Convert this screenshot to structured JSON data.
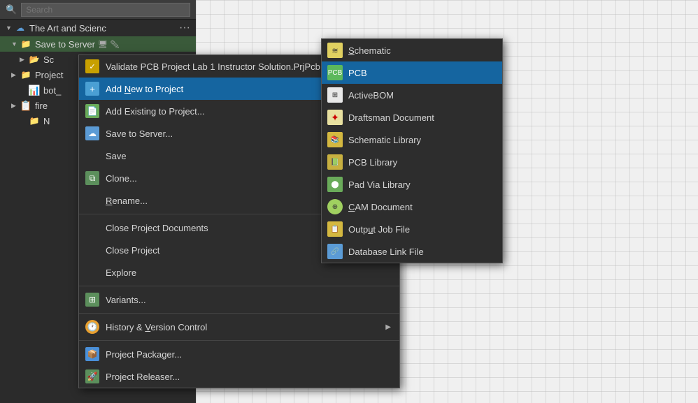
{
  "sidebar": {
    "search_placeholder": "Search",
    "items": [
      {
        "id": "cloud-root",
        "label": "The Art and Scienc",
        "level": 0,
        "icon": "cloud",
        "has_dots": true
      },
      {
        "id": "project-root",
        "label": "Save to Server",
        "level": 1,
        "icon": "folder-green"
      },
      {
        "id": "sc-folder",
        "label": "Sc",
        "level": 2,
        "icon": "folder-green"
      },
      {
        "id": "project-item",
        "label": "Project",
        "level": 1,
        "icon": "folder-blue"
      },
      {
        "id": "bot-item",
        "label": "bot_",
        "level": 2,
        "icon": "excel"
      },
      {
        "id": "fire-item",
        "label": "fire",
        "level": 1,
        "icon": "file"
      },
      {
        "id": "n-item",
        "label": "N",
        "level": 2,
        "icon": "folder-orange"
      }
    ]
  },
  "context_menu": {
    "items": [
      {
        "id": "validate",
        "label": "Validate PCB Project Lab 1 Instructor Solution.PrjPcb",
        "icon": "validate",
        "has_arrow": false
      },
      {
        "id": "add-new",
        "label": "Add New to Project",
        "icon": "add-new",
        "has_arrow": true,
        "highlighted": true
      },
      {
        "id": "add-existing",
        "label": "Add Existing to Project...",
        "icon": "add-existing",
        "has_arrow": false
      },
      {
        "id": "save-server",
        "label": "Save to Server...",
        "icon": "save-server",
        "has_arrow": false
      },
      {
        "id": "save",
        "label": "Save",
        "icon": null,
        "has_arrow": false
      },
      {
        "id": "clone",
        "label": "Clone...",
        "icon": "clone",
        "has_arrow": false
      },
      {
        "id": "rename",
        "label": "Rename...",
        "icon": null,
        "has_arrow": false
      },
      {
        "id": "sep1",
        "type": "separator"
      },
      {
        "id": "close-docs",
        "label": "Close Project Documents",
        "icon": null,
        "has_arrow": false
      },
      {
        "id": "close-project",
        "label": "Close Project",
        "icon": null,
        "has_arrow": false
      },
      {
        "id": "explore",
        "label": "Explore",
        "icon": null,
        "has_arrow": false
      },
      {
        "id": "sep2",
        "type": "separator"
      },
      {
        "id": "variants",
        "label": "Variants...",
        "icon": "variants",
        "has_arrow": false
      },
      {
        "id": "sep3",
        "type": "separator"
      },
      {
        "id": "history",
        "label": "History & Version Control",
        "icon": "history",
        "has_arrow": true
      },
      {
        "id": "sep4",
        "type": "separator"
      },
      {
        "id": "packager",
        "label": "Project Packager...",
        "icon": "packager",
        "has_arrow": false
      },
      {
        "id": "releaser",
        "label": "Project Releaser...",
        "icon": "releaser",
        "has_arrow": false
      }
    ]
  },
  "submenu": {
    "items": [
      {
        "id": "schematic",
        "label": "Schematic",
        "icon": "schematic",
        "highlighted": false
      },
      {
        "id": "pcb",
        "label": "PCB",
        "icon": "pcb",
        "highlighted": true
      },
      {
        "id": "activebom",
        "label": "ActiveBOM",
        "icon": "activebom",
        "highlighted": false
      },
      {
        "id": "draftsman",
        "label": "Draftsman Document",
        "icon": "draftsman",
        "highlighted": false
      },
      {
        "id": "schlib",
        "label": "Schematic Library",
        "icon": "schlib",
        "highlighted": false
      },
      {
        "id": "pcblib",
        "label": "PCB Library",
        "icon": "pcblib",
        "highlighted": false
      },
      {
        "id": "padvia",
        "label": "Pad Via Library",
        "icon": "padvia",
        "highlighted": false
      },
      {
        "id": "cam",
        "label": "CAM Document",
        "icon": "cam",
        "highlighted": false
      },
      {
        "id": "output",
        "label": "Output Job File",
        "icon": "output",
        "highlighted": false
      },
      {
        "id": "dblink",
        "label": "Database Link File",
        "icon": "dblink",
        "highlighted": false
      }
    ]
  },
  "labels": {
    "search": "Search",
    "the_art": "The Art and Scienc",
    "save_to_server": "Save to Server",
    "sc": "Sc",
    "project": "Project",
    "bot": "bot_",
    "fire": "fire",
    "n": "N",
    "validate": "Validate PCB Project Lab 1 Instructor Solution.PrjPcb",
    "add_new": "Add New to Project",
    "add_existing": "Add Existing to Project...",
    "save_server_menu": "Save to Server...",
    "save": "Save",
    "clone": "Clone...",
    "rename": "Rename...",
    "close_docs": "Close Project Documents",
    "close_project": "Close Project",
    "explore": "Explore",
    "variants": "Variants...",
    "history": "History & Version Control",
    "packager": "Project Packager...",
    "releaser": "Project Releaser...",
    "schematic": "Schematic",
    "pcb": "PCB",
    "activebom": "ActiveBOM",
    "draftsman": "Draftsman Document",
    "schlib": "Schematic Library",
    "pcblib": "PCB Library",
    "padvia": "Pad Via Library",
    "cam": "CAM Document",
    "output": "Output Job File",
    "dblink": "Database Link File"
  }
}
